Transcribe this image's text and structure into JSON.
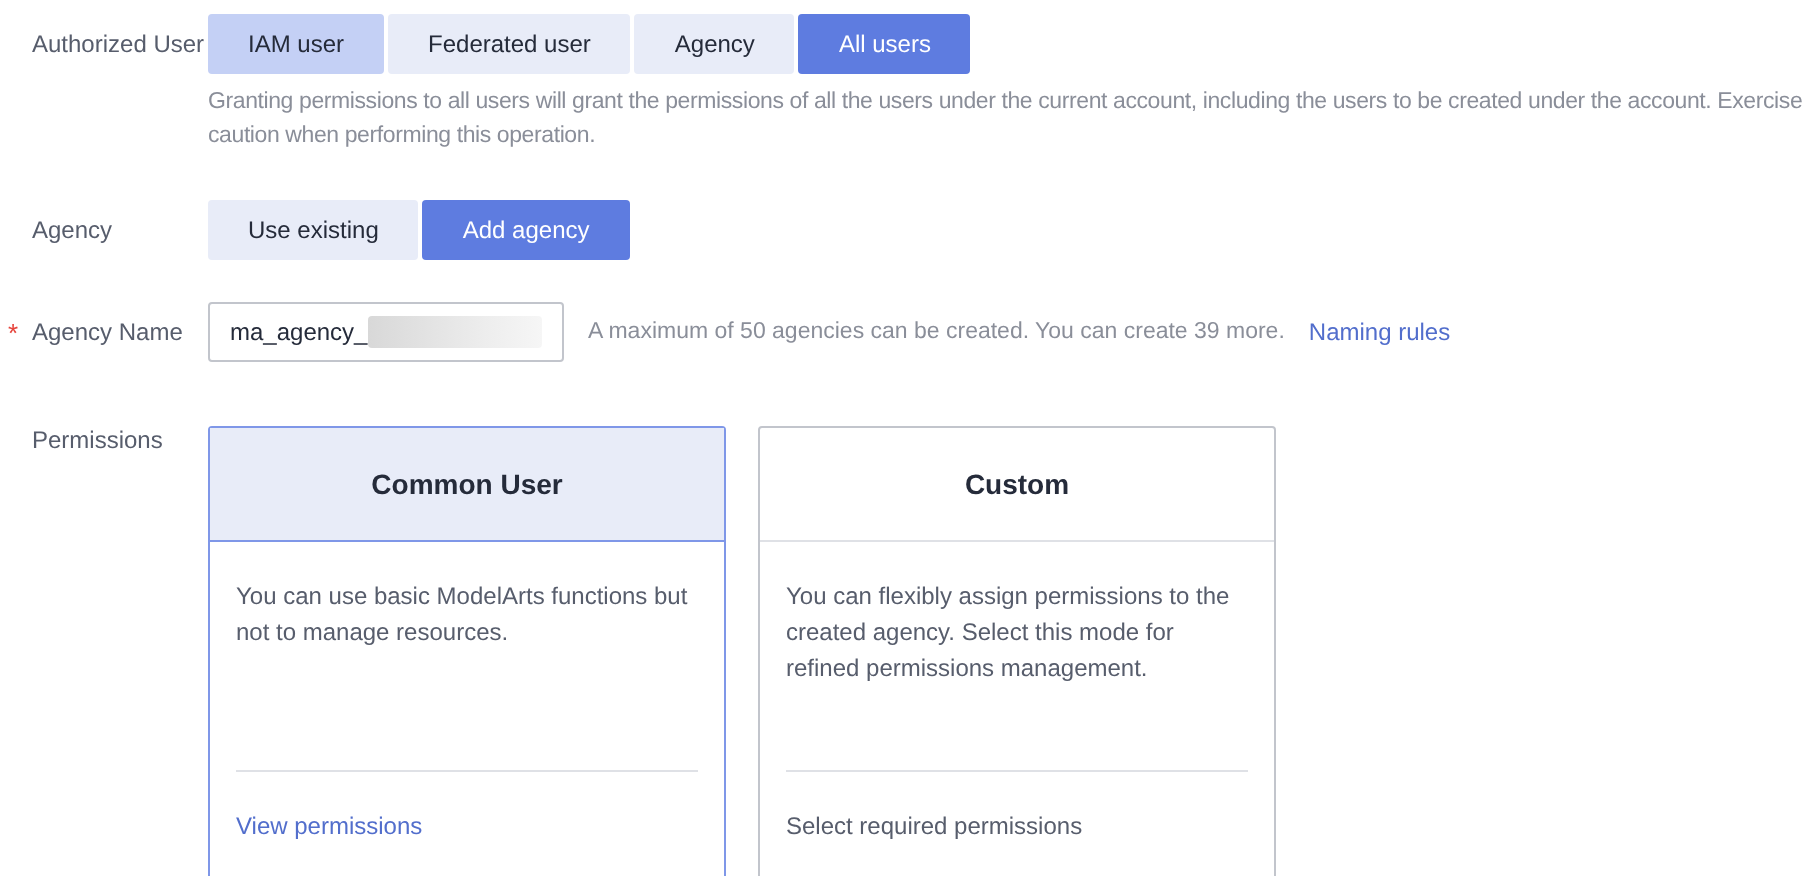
{
  "authorized_user": {
    "label": "Authorized User",
    "options": [
      {
        "label": "IAM user",
        "selected": false,
        "hovered": true
      },
      {
        "label": "Federated user",
        "selected": false,
        "hovered": false
      },
      {
        "label": "Agency",
        "selected": false,
        "hovered": false
      },
      {
        "label": "All users",
        "selected": true,
        "hovered": false
      }
    ],
    "hint": "Granting permissions to all users will grant the permissions of all the users under the current account, including the users to be created under the account. Exercise caution when performing this operation."
  },
  "agency": {
    "label": "Agency",
    "options": [
      {
        "label": "Use existing",
        "selected": false,
        "hovered": false
      },
      {
        "label": "Add agency",
        "selected": true,
        "hovered": false
      }
    ]
  },
  "agency_name": {
    "label": "Agency Name",
    "required_mark": "*",
    "value": "ma_agency_",
    "redacted": true,
    "hint": "A maximum of 50 agencies can be created. You can create 39 more.",
    "link": "Naming rules"
  },
  "permissions": {
    "label": "Permissions",
    "cards": [
      {
        "title": "Common User",
        "selected": true,
        "description": "You can use basic ModelArts functions but not to manage resources.",
        "footer": "View permissions",
        "kind": "link"
      },
      {
        "title": "Custom",
        "selected": false,
        "description": "You can flexibly assign permissions to the created agency. Select this mode for refined permissions management.",
        "footer": "Select required permissions",
        "kind": "text"
      }
    ]
  }
}
